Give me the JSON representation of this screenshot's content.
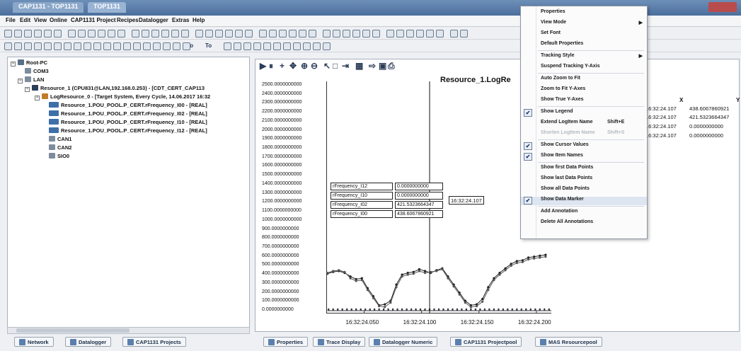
{
  "window": {
    "tabs": [
      "CAP1131 - TOP1131",
      "TOP1131"
    ]
  },
  "menubar": {
    "items": [
      "File",
      "Edit",
      "View",
      "Online",
      "CAP1131 Project",
      "Recipes",
      "Datalogger",
      "Extras",
      "Help"
    ]
  },
  "toolbar2": {
    "to_label_1": "To",
    "to_label_2": "To"
  },
  "tree": {
    "root": "Root-PC",
    "com": "COM3",
    "lan": "LAN",
    "resource": "Resource_1 (CPU831@LAN,192.168.0.253) - [CDT_CERT_CAP113",
    "logresource": "LogResource_0 - [Target System, Every Cycle, 14.06.2017 16:32",
    "vars": [
      "Resource_1.POU_POOL.P_CERT.rFrequency_I00 - [REAL]",
      "Resource_1.POU_POOL.P_CERT.rFrequency_I02 - [REAL]",
      "Resource_1.POU_POOL.P_CERT.rFrequency_I10 - [REAL]",
      "Resource_1.POU_POOL.P_CERT.rFrequency_I12 - [REAL]"
    ],
    "can1": "CAN1",
    "can2": "CAN2",
    "sio": "SIO0"
  },
  "left_tabs": [
    "Network",
    "Datalogger",
    "CAP1131 Projects"
  ],
  "bottom_tabs": [
    "Properties",
    "Trace Display",
    "Datalogger Numeric",
    "CAP1131 Projectpool",
    "MAS Resourcepool"
  ],
  "chart": {
    "title": "Resource_1.LogRe",
    "cursor_time": "16:32:24.107"
  },
  "legend": {
    "col_x": "X",
    "col_y": "Y",
    "rows": [
      {
        "x": "16:32:24.107",
        "y": "438.6067860921"
      },
      {
        "x": "16:32:24.107",
        "y": "421.5323664347"
      },
      {
        "x": "16:32:24.107",
        "y": "0.0000000000"
      },
      {
        "x": "16:32:24.107",
        "y": "0.0000000000"
      }
    ]
  },
  "data_markers": [
    {
      "name": "rFrequency_I12",
      "value": "0.0000000000"
    },
    {
      "name": "rFrequency_I10",
      "value": "0.0000000000"
    },
    {
      "name": "rFrequency_I02",
      "value": "421.5323664347"
    },
    {
      "name": "rFrequency_I00",
      "value": "438.6067860921"
    }
  ],
  "context_menu": {
    "items": [
      {
        "label": "Properties",
        "checked": false,
        "submenu": false,
        "disabled": false
      },
      {
        "label": "View Mode",
        "checked": false,
        "submenu": true,
        "disabled": false
      },
      {
        "label": "Set Font",
        "checked": false,
        "submenu": false,
        "disabled": false
      },
      {
        "label": "Default Properties",
        "checked": false,
        "submenu": false,
        "disabled": false
      },
      {
        "label": "Tracking Style",
        "checked": false,
        "submenu": true,
        "disabled": false
      },
      {
        "label": "Suspend Tracking Y-Axis",
        "checked": false,
        "submenu": false,
        "disabled": false
      },
      {
        "label": "Auto Zoom to Fit",
        "checked": false,
        "submenu": false,
        "disabled": false
      },
      {
        "label": "Zoom to Fit Y-Axes",
        "checked": false,
        "submenu": false,
        "disabled": false
      },
      {
        "label": "Show True Y-Axes",
        "checked": false,
        "submenu": false,
        "disabled": false
      },
      {
        "label": "Show Legend",
        "checked": true,
        "submenu": false,
        "disabled": false
      },
      {
        "label": "Extend LogItem Name",
        "shortcut": "Shift+E",
        "checked": false,
        "submenu": false,
        "disabled": false
      },
      {
        "label": "Shorten LogItem Name",
        "shortcut": "Shift+S",
        "checked": false,
        "submenu": false,
        "disabled": true
      },
      {
        "label": "Show Cursor Values",
        "checked": true,
        "submenu": false,
        "disabled": false
      },
      {
        "label": "Show Item Names",
        "checked": true,
        "submenu": false,
        "disabled": false
      },
      {
        "label": "Show first Data Points",
        "checked": false,
        "submenu": false,
        "disabled": false
      },
      {
        "label": "Show last Data Points",
        "checked": false,
        "submenu": false,
        "disabled": false
      },
      {
        "label": "Show all Data Points",
        "checked": false,
        "submenu": false,
        "disabled": false
      },
      {
        "label": "Show Data Marker",
        "checked": true,
        "submenu": false,
        "disabled": false,
        "highlighted": true
      },
      {
        "label": "Add Annotation",
        "checked": false,
        "submenu": false,
        "disabled": false
      },
      {
        "label": "Delete All Annotations",
        "checked": false,
        "submenu": false,
        "disabled": false
      }
    ]
  },
  "chart_data": {
    "type": "line",
    "title": "Resource_1.LogRe",
    "ylim": [
      0,
      2500
    ],
    "yticks": [
      "2500.0000000000",
      "2400.0000000000",
      "2300.0000000000",
      "2200.0000000000",
      "2100.0000000000",
      "2000.0000000000",
      "1900.0000000000",
      "1800.0000000000",
      "1700.0000000000",
      "1600.0000000000",
      "1500.0000000000",
      "1400.0000000000",
      "1300.0000000000",
      "1200.0000000000",
      "1100.0000000000",
      "1000.0000000000",
      "900.0000000000",
      "800.0000000000",
      "700.0000000000",
      "600.0000000000",
      "500.0000000000",
      "400.0000000000",
      "300.0000000000",
      "200.0000000000",
      "100.0000000000",
      "0.0000000000"
    ],
    "xticks": [
      "16:32:24.050",
      "16:32:24.100",
      "16:32:24.150",
      "16:32:24.200"
    ],
    "xtick_ms": [
      50,
      100,
      150,
      200
    ],
    "xlim_ms": [
      17,
      213
    ],
    "cursor_ms": 107,
    "series": [
      {
        "name": "rFrequency_I00",
        "color": "#222222",
        "x": [
          18,
          23,
          28,
          33,
          38,
          43,
          48,
          53,
          58,
          63,
          68,
          73,
          78,
          83,
          88,
          93,
          98,
          103,
          108,
          113,
          118,
          123,
          128,
          133,
          138,
          143,
          148,
          153,
          158,
          163,
          168,
          173,
          178,
          183,
          188,
          193,
          198,
          203,
          208
        ],
        "y": [
          410,
          430,
          440,
          420,
          380,
          350,
          360,
          250,
          160,
          60,
          70,
          110,
          290,
          400,
          420,
          430,
          460,
          440,
          420,
          450,
          470,
          380,
          290,
          200,
          110,
          60,
          70,
          130,
          260,
          360,
          420,
          470,
          520,
          550,
          560,
          590,
          600,
          610,
          620
        ]
      },
      {
        "name": "rFrequency_I02",
        "color": "#555555",
        "x": [
          18,
          23,
          28,
          33,
          38,
          43,
          48,
          53,
          58,
          63,
          68,
          73,
          78,
          83,
          88,
          93,
          98,
          103,
          108,
          113,
          118,
          123,
          128,
          133,
          138,
          143,
          148,
          153,
          158,
          163,
          168,
          173,
          178,
          183,
          188,
          193,
          198,
          203,
          208
        ],
        "y": [
          420,
          440,
          450,
          430,
          360,
          330,
          340,
          230,
          140,
          50,
          40,
          90,
          260,
          380,
          400,
          410,
          440,
          420,
          430,
          440,
          460,
          360,
          270,
          180,
          90,
          40,
          50,
          100,
          230,
          340,
          400,
          450,
          500,
          530,
          540,
          570,
          580,
          590,
          600
        ]
      },
      {
        "name": "rFrequency_I10",
        "color": "#2f4a7a",
        "x": [
          18,
          213
        ],
        "y": [
          0,
          0
        ]
      },
      {
        "name": "rFrequency_I12",
        "color": "#333333",
        "x": [
          18,
          213
        ],
        "y": [
          0,
          0
        ]
      }
    ]
  }
}
